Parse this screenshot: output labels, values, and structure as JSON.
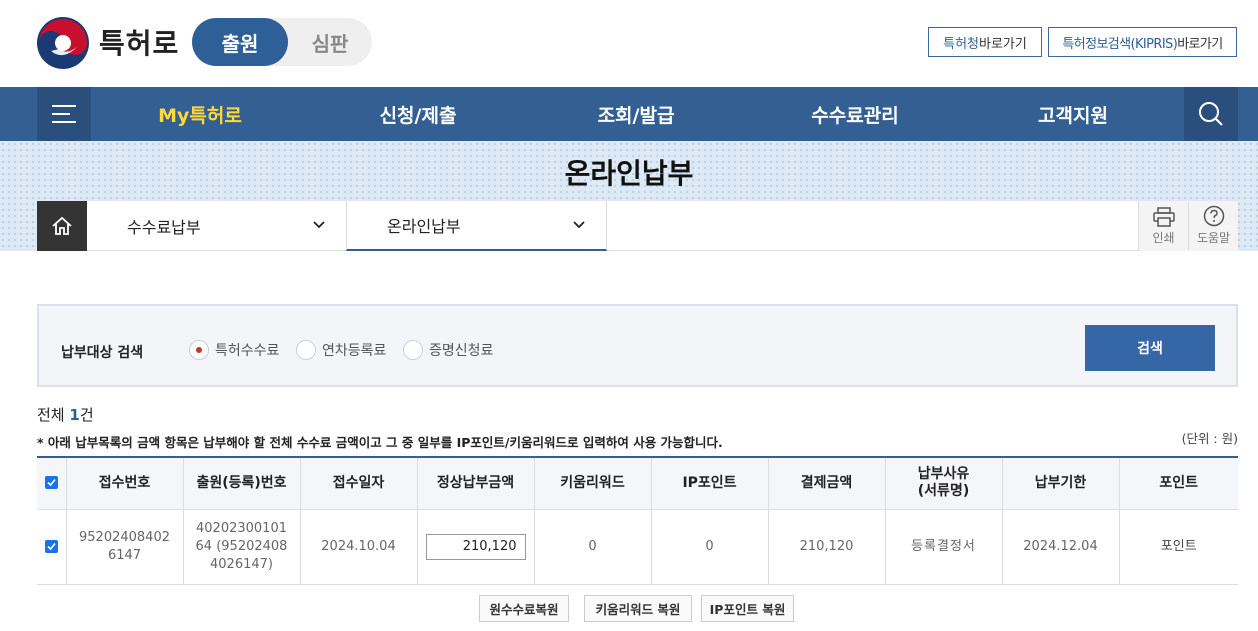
{
  "header": {
    "brand": "특허로",
    "mode_active": "출원",
    "mode_inactive": "심판",
    "link_kipo_hl": "특허청",
    "link_kipo_rest": " 바로가기",
    "link_kipris_hl": "특허정보검색(KIPRIS)",
    "link_kipris_rest": " 바로가기"
  },
  "gnb": {
    "items": [
      "My특허로",
      "신청/제출",
      "조회/발급",
      "수수료관리",
      "고객지원"
    ],
    "active_color": "#ffd83a"
  },
  "page": {
    "title": "온라인납부"
  },
  "breadcrumb": {
    "level1": "수수료납부",
    "level2": "온라인납부",
    "print": "인쇄",
    "help": "도움말"
  },
  "search": {
    "label": "납부대상 검색",
    "options": [
      "특허수수료",
      "연차등록료",
      "증명신청료"
    ],
    "selected": "특허수수료",
    "button": "검색"
  },
  "summary": {
    "total_prefix": "전체 ",
    "total_count": "1",
    "total_suffix": "건",
    "note": "* 아래 납부목록의 금액 항목은 납부해야 할 전체 수수료 금액이고 그 중 일부를 IP포인트/키움리워드로 입력하여 사용 가능합니다.",
    "unit": "(단위 : 원)"
  },
  "table": {
    "headers": [
      "접수번호",
      "출원(등록)번호",
      "접수일자",
      "정상납부금액",
      "키움리워드",
      "IP포인트",
      "결제금액",
      "납부사유\n(서류명)",
      "납부기한",
      "포인트"
    ],
    "rows": [
      {
        "checked": true,
        "receipt_no": "952024084026147",
        "app_no": "4020230010164 (952024084026147)",
        "receipt_date": "2024.10.04",
        "normal_amount": "210,120",
        "kium_reward": "0",
        "ip_point": "0",
        "payment": "210,120",
        "reason": "등록결정서",
        "due_date": "2024.12.04",
        "point": "포인트"
      }
    ]
  },
  "actions": {
    "restore_fee": "원수수료복원",
    "restore_kium": "키움리워드 복원",
    "restore_ip": "IP포인트 복원"
  }
}
